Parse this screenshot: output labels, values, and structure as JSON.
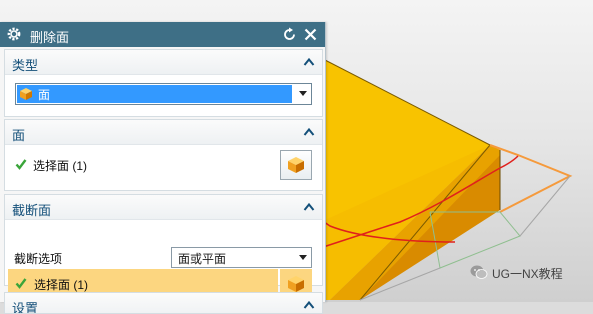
{
  "dialog": {
    "title": "删除面",
    "sections": {
      "type": {
        "header": "类型",
        "select_value": "面"
      },
      "face": {
        "header": "面",
        "select_label": "选择面 (1)"
      },
      "cut": {
        "header": "截断面",
        "option_label": "截断选项",
        "option_value": "面或平面",
        "select_label": "选择面 (1)"
      },
      "settings": {
        "header": "设置"
      }
    }
  },
  "watermark": {
    "text": "UG一NX教程"
  },
  "colors": {
    "titlebar": "#3e6f86",
    "section_header_text": "#14507a",
    "selected_highlight": "#3399ff",
    "active_row": "#fcd680",
    "check_green": "#3aa53a",
    "solid_face": "#f5b800"
  },
  "icons": [
    "gear-icon",
    "reset-icon",
    "close-icon",
    "chevron-up-icon",
    "cube-icon",
    "check-icon",
    "face-select-icon",
    "wechat-icon"
  ]
}
